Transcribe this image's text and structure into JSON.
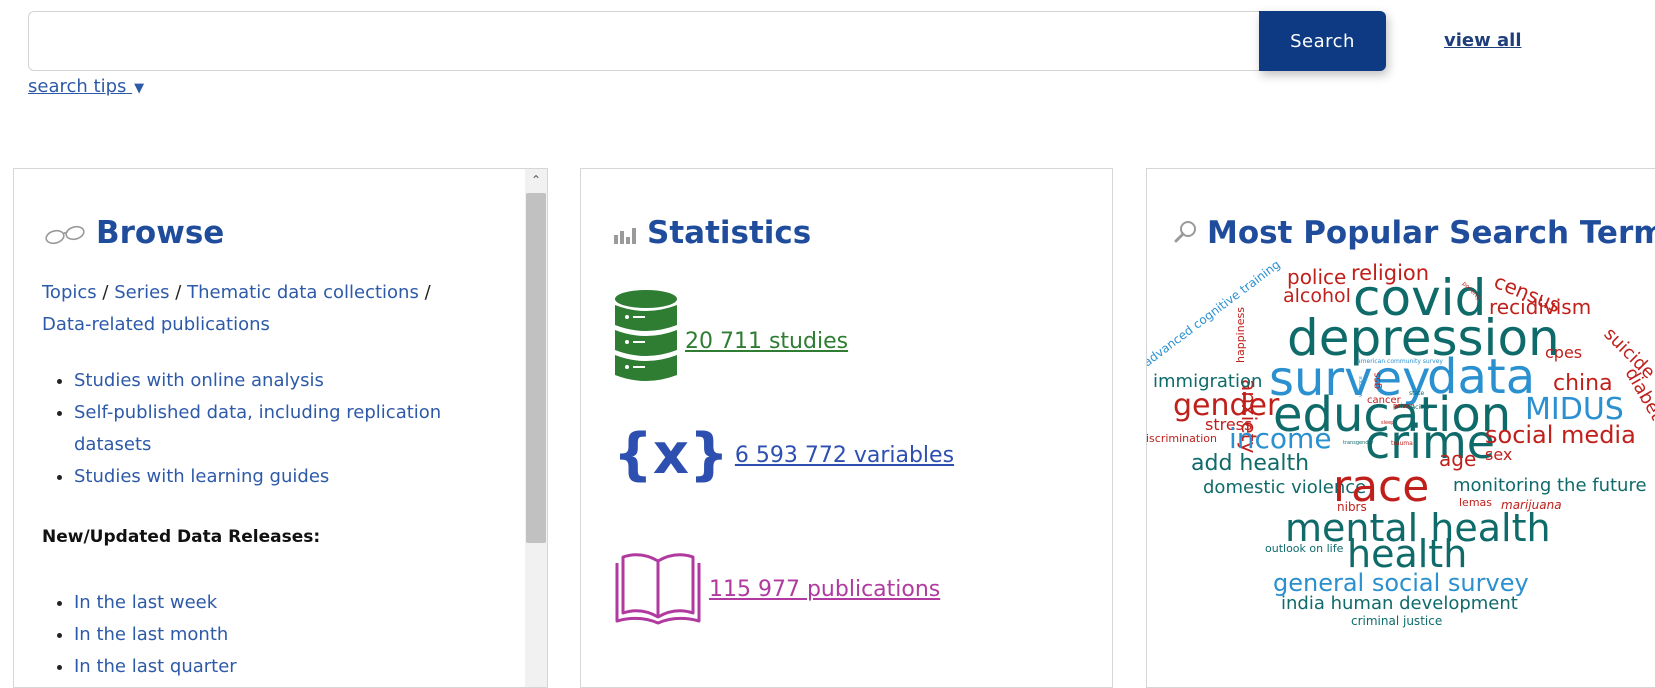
{
  "search": {
    "placeholder": "",
    "button_label": "Search",
    "view_all": "view all",
    "tips": "search tips"
  },
  "browse": {
    "title": "Browse",
    "links": [
      "Topics",
      "Series",
      "Thematic data collections",
      "Data-related publications"
    ],
    "separator": "/",
    "bullets": [
      "Studies with online analysis",
      "Self-published data, including replication datasets",
      "Studies with learning guides"
    ],
    "releases_heading": "New/Updated Data Releases:",
    "releases": [
      "In the last week",
      "In the last month",
      "In the last quarter"
    ]
  },
  "statistics": {
    "title": "Statistics",
    "studies": "20 711 studies",
    "variables": "6 593 772 variables",
    "publications": "115 977 publications"
  },
  "popular": {
    "title": "Most Popular Search Terms",
    "terms": {
      "police": "police",
      "religion": "religion",
      "alcohol": "alcohol",
      "covid": "covid",
      "census": "census",
      "recidivism": "recidivism",
      "advanced_cognitive_training": "advanced cognitive training",
      "happiness": "happiness",
      "anxiety": "anxiety",
      "depression": "depression",
      "cpes": "cpes",
      "suicide": "suicide",
      "immigration": "immigration",
      "survey": "survey",
      "data": "data",
      "china": "china",
      "diabetes": "diabetes",
      "gender": "gender",
      "stress": "stress",
      "education": "education",
      "midus": "MIDUS",
      "discrimination": "discrimination",
      "income": "income",
      "crime": "crime",
      "social_media": "social media",
      "add_health": "add health",
      "age": "age",
      "sex": "sex",
      "domestic_violence": "domestic violence",
      "race": "race",
      "monitoring_the_future": "monitoring the future",
      "nibrs": "nibrs",
      "lemas": "lemas",
      "marijuana": "marijuana",
      "mental_health": "mental health",
      "outlook_on_life": "outlook on life",
      "health": "health",
      "general_social_survey": "general social survey",
      "india_human_development": "india human development",
      "criminal_justice": "criminal justice",
      "american_community_survey": "american community survey",
      "cancer": "cancer",
      "gss": "gss",
      "prison": "prison",
      "state": "state",
      "racism": "racism",
      "violence": "violence",
      "sleep": "sleep",
      "transgender": "transgender",
      "trauma": "trauma",
      "poverty": "poverty"
    }
  },
  "colors": {
    "brand_blue": "#0d3a82",
    "title_blue": "#1f4d9c",
    "cloud_red": "#c0201b",
    "cloud_teal": "#0f6a6a",
    "cloud_lightblue": "#2a90cf"
  }
}
